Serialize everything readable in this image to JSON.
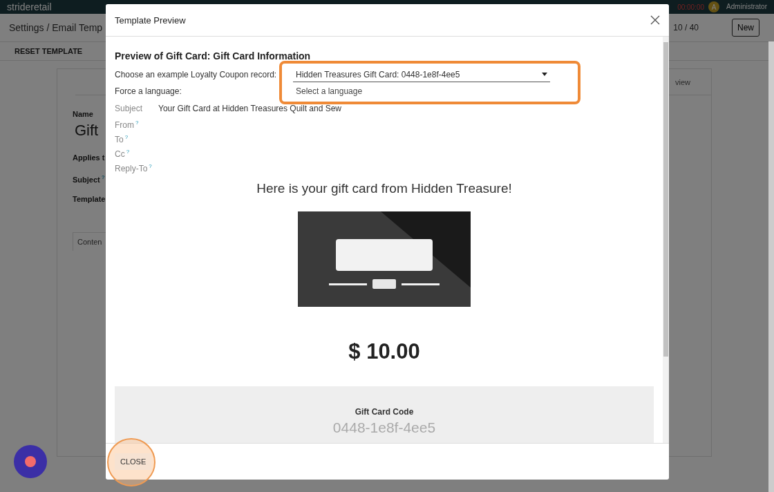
{
  "topbar": {
    "brand": "strideretail",
    "timer": "00:00:00",
    "avatar": "A",
    "user": "Administrator"
  },
  "breadcrumb": "Settings / Email Temp",
  "pager": "10 / 40",
  "new_button": "New",
  "reset_button": "RESET TEMPLATE",
  "form": {
    "name_label": "Name",
    "name_value": "Gift",
    "fields": [
      {
        "label": "Applies t"
      },
      {
        "label": "Subject",
        "help": "?"
      },
      {
        "label": "Template"
      }
    ],
    "tab": "Conten",
    "side_tab": "view"
  },
  "dialog": {
    "title": "Template Preview",
    "heading": "Preview of Gift Card: Gift Card Information",
    "record_label": "Choose an example Loyalty Coupon record:",
    "record_value": "Hidden Treasures Gift Card: 0448-1e8f-4ee5",
    "language_label": "Force a language:",
    "language_placeholder": "Select a language",
    "highlighted": true,
    "headers": [
      {
        "label": "Subject",
        "value": "Your Gift Card at Hidden Treasures Quilt and Sew"
      },
      {
        "label": "From",
        "help": "?"
      },
      {
        "label": "To",
        "help": "?"
      },
      {
        "label": "Cc",
        "help": "?"
      },
      {
        "label": "Reply-To",
        "help": "?"
      }
    ],
    "email": {
      "greeting": "Here is your gift card from Hidden Treasure!",
      "amount": "$ 10.00",
      "code_label": "Gift Card Code",
      "code": "0448-1e8f-4ee5"
    },
    "close_button": "CLOSE",
    "close_highlighted": true
  }
}
